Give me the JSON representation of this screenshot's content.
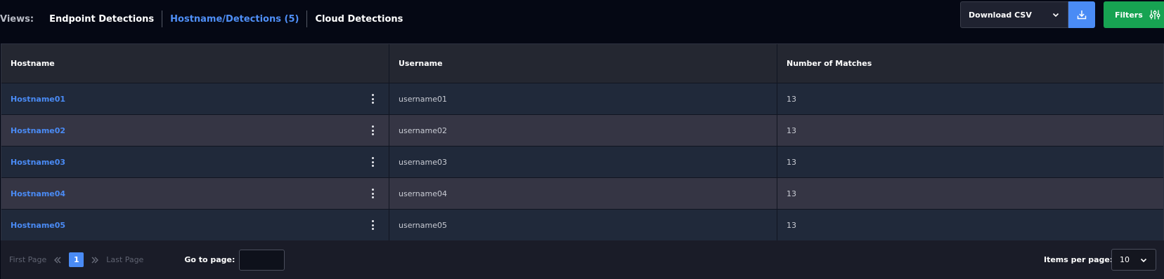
{
  "views": {
    "label": "Views:",
    "tabs": [
      {
        "label": "Endpoint Detections",
        "active": false
      },
      {
        "label": "Hostname/Detections (5)",
        "active": true
      },
      {
        "label": "Cloud Detections",
        "active": false
      }
    ]
  },
  "toolbar": {
    "csv_label": "Download CSV",
    "filters_label": "Filters"
  },
  "table": {
    "columns": [
      "Hostname",
      "Username",
      "Number of Matches"
    ],
    "rows": [
      {
        "hostname": "Hostname01",
        "username": "username01",
        "matches": "13"
      },
      {
        "hostname": "Hostname02",
        "username": "username02",
        "matches": "13"
      },
      {
        "hostname": "Hostname03",
        "username": "username03",
        "matches": "13"
      },
      {
        "hostname": "Hostname04",
        "username": "username04",
        "matches": "13"
      },
      {
        "hostname": "Hostname05",
        "username": "username05",
        "matches": "13"
      }
    ]
  },
  "pagination": {
    "first_page": "First Page",
    "current_page": "1",
    "last_page": "Last Page",
    "goto_label": "Go to page:",
    "goto_value": "",
    "items_per_page_label": "Items per page:",
    "items_per_page_value": "10"
  },
  "colors": {
    "accent": "#4a8bf5",
    "filters_green": "#17a352",
    "background": "#050814"
  },
  "icons": {
    "chevron": "chevron-down-icon",
    "download": "download-icon",
    "filters": "sliders-icon",
    "kebab": "kebab-menu-icon",
    "first": "double-chevron-left-icon",
    "next": "double-chevron-right-icon"
  }
}
